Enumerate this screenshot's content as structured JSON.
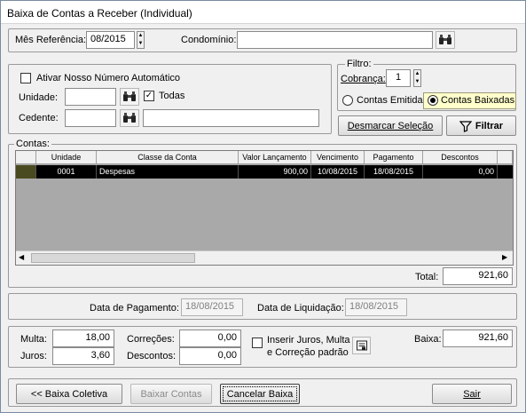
{
  "window": {
    "title": "Baixa de Contas a Receber (Individual)"
  },
  "top": {
    "mes_label": "Mês Referência:",
    "mes_value": "08/2015",
    "condominio_label": "Condomínio:",
    "condominio_value": ""
  },
  "filters": {
    "ativar_label": "Ativar Nosso Número Automático",
    "ativar_checked": false,
    "unidade_label": "Unidade:",
    "unidade_value": "",
    "todas_label": "Todas",
    "todas_checked": true,
    "cedente_label": "Cedente:",
    "cedente_code": "",
    "cedente_name": ""
  },
  "filtro": {
    "title": "Filtro:",
    "cobranca_label": "Cobrança:",
    "cobranca_value": "1",
    "option_emitidas": "Contas Emitidas",
    "option_baixadas": "Contas Baixadas",
    "selected": "Contas Baixadas",
    "desmarcar_label": "Desmarcar Seleção",
    "filtrar_label": "Filtrar"
  },
  "contas": {
    "title": "Contas:",
    "columns": [
      "Unidade",
      "Classe da Conta",
      "Valor Lançamento",
      "Vencimento",
      "Pagamento",
      "Descontos"
    ],
    "rows": [
      {
        "unidade": "0001",
        "classe": "Despesas",
        "valor": "900,00",
        "vencimento": "10/08/2015",
        "pagamento": "18/08/2015",
        "descontos": "0,00"
      }
    ],
    "total_label": "Total:",
    "total_value": "921,60"
  },
  "datas": {
    "pagamento_label": "Data de Pagamento:",
    "pagamento_value": "18/08/2015",
    "liquidacao_label": "Data de Liquidação:",
    "liquidacao_value": "18/08/2015"
  },
  "valores": {
    "multa_label": "Multa:",
    "multa_value": "18,00",
    "juros_label": "Juros:",
    "juros_value": "3,60",
    "correcoes_label": "Correções:",
    "correcoes_value": "0,00",
    "descontos_label": "Descontos:",
    "descontos_value": "0,00",
    "inserir_label_1": "Inserir Juros, Multa",
    "inserir_label_2": "e Correção padrão",
    "baixa_label": "Baixa:",
    "baixa_value": "921,60"
  },
  "footer": {
    "baixa_coletiva": "<< Baixa Coletiva",
    "baixar_contas": "Baixar Contas",
    "cancelar_baixa": "Cancelar Baixa",
    "sair": "Sair"
  }
}
